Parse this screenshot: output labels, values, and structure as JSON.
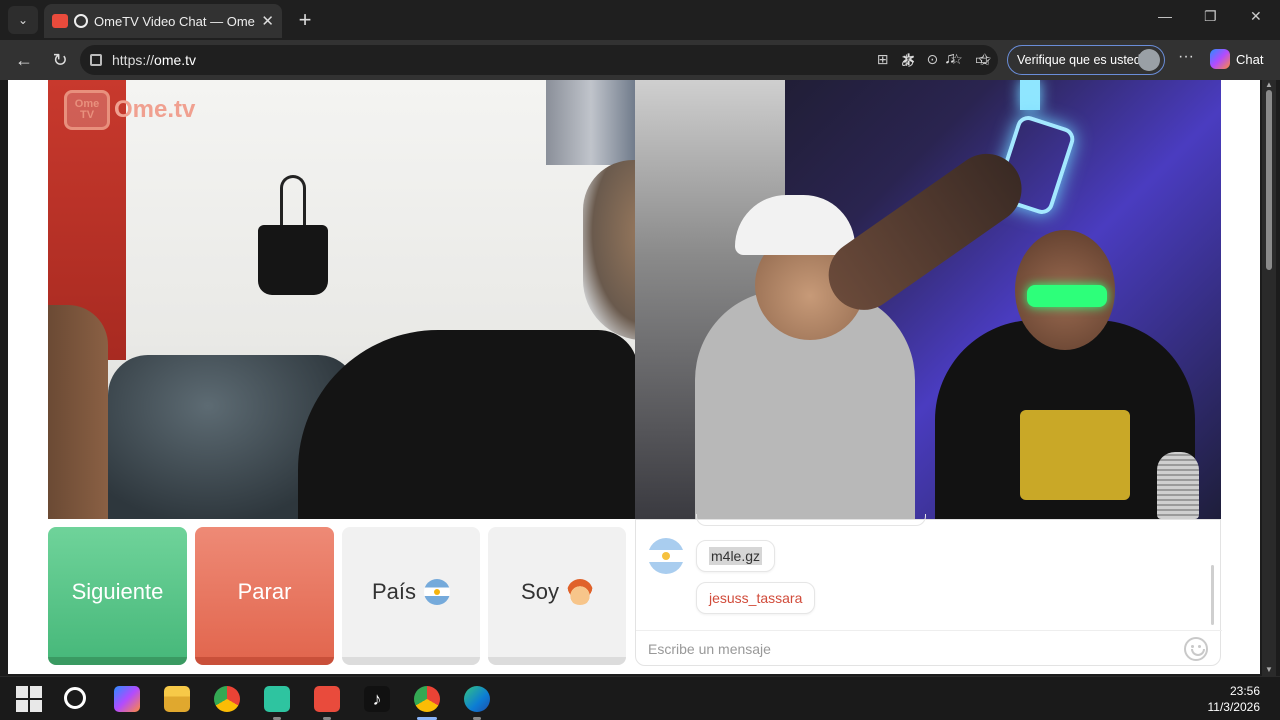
{
  "browser": {
    "tab_title": "OmeTV Video Chat — Omegle",
    "tab_close": "✕",
    "new_tab": "+",
    "url_prefix": "https://",
    "url_host": "ome.tv",
    "verify_label": "Verifique que es usted",
    "chat_label": "Chat",
    "more": "···"
  },
  "page": {
    "logo_box_line1": "Ome",
    "logo_box_line2": "TV",
    "logo_text": "Ome.tv"
  },
  "controls": {
    "next_label": "Siguiente",
    "stop_label": "Parar",
    "country_label": "País",
    "gender_label": "Soy"
  },
  "chat": {
    "messages": [
      {
        "text": "m4le.gz",
        "color": "#333333"
      },
      {
        "text": "jesuss_tassara",
        "color": "#d14b3a"
      }
    ],
    "input_placeholder": "Escribe un mensaje"
  },
  "colors": {
    "next": "#48b97b",
    "stop": "#e2674f",
    "accent": "#e8907d"
  },
  "taskbar": {
    "time": "23:56",
    "date": "11/3/2026",
    "icons": [
      "windows-icon",
      "search-icon",
      "copilot-icon",
      "file-explorer-icon",
      "chrome-icon",
      "capcut-icon",
      "ometv-icon",
      "tiktok-icon",
      "chrome-profile-icon",
      "edge-icon"
    ]
  }
}
